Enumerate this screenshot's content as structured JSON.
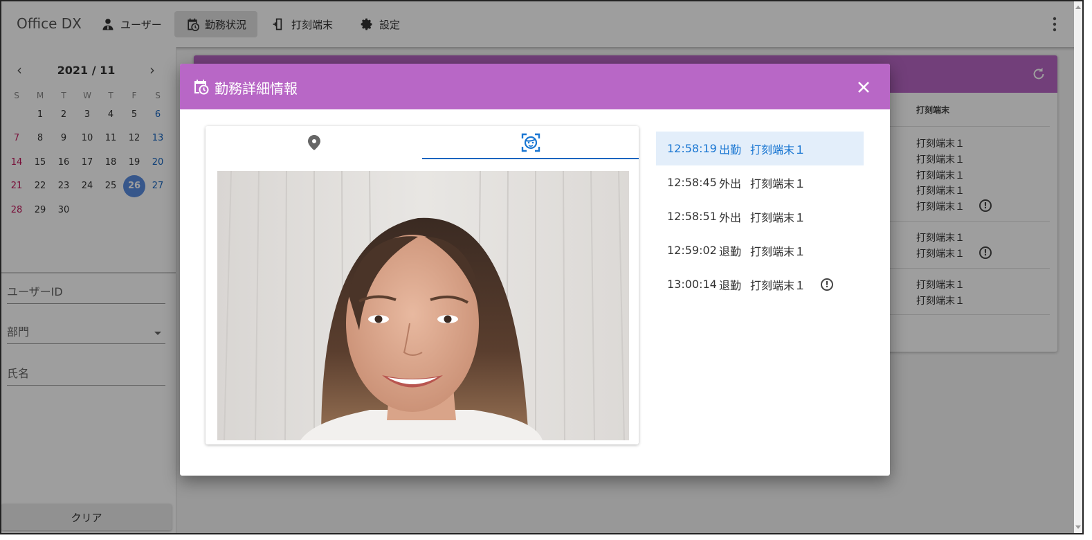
{
  "app": {
    "brand": "Office DX"
  },
  "nav": [
    {
      "label": "ユーザー",
      "icon": "user-icon"
    },
    {
      "label": "勤務状況",
      "icon": "calendar-clock-icon",
      "active": true
    },
    {
      "label": "打刻端末",
      "icon": "device-icon"
    },
    {
      "label": "設定",
      "icon": "gear-icon"
    }
  ],
  "calendar": {
    "title": "2021 / 11",
    "dow": [
      "S",
      "M",
      "T",
      "W",
      "T",
      "F",
      "S"
    ],
    "weeks": [
      [
        "",
        "1",
        "2",
        "3",
        "4",
        "5",
        "6"
      ],
      [
        "7",
        "8",
        "9",
        "10",
        "11",
        "12",
        "13"
      ],
      [
        "14",
        "15",
        "16",
        "17",
        "18",
        "19",
        "20"
      ],
      [
        "21",
        "22",
        "23",
        "24",
        "25",
        "26",
        "27"
      ],
      [
        "28",
        "29",
        "30",
        "",
        "",
        "",
        ""
      ]
    ],
    "selected": "26"
  },
  "filters": {
    "user_id": "ユーザーID",
    "department": "部門",
    "name": "氏名"
  },
  "clear_label": "クリア",
  "table": {
    "header": "打刻端末",
    "groups": [
      {
        "rows": [
          "打刻端末１",
          "打刻端末１",
          "打刻端末１",
          "打刻端末１",
          "打刻端末１"
        ],
        "warn_row": 4
      },
      {
        "rows": [
          "打刻端末１",
          "打刻端末１"
        ],
        "warn_row": 1
      },
      {
        "rows": [
          "打刻端末１",
          "打刻端末１"
        ],
        "warn_row": -1
      }
    ]
  },
  "modal": {
    "title": "勤務詳細情報",
    "tabs": [
      {
        "icon": "location-pin-icon"
      },
      {
        "icon": "face-recognition-icon",
        "active": true
      }
    ],
    "records": [
      {
        "time": "12:58:19",
        "kind": "出勤",
        "device": "打刻端末１",
        "selected": true,
        "warn": false
      },
      {
        "time": "12:58:45",
        "kind": "外出",
        "device": "打刻端末１",
        "selected": false,
        "warn": false
      },
      {
        "time": "12:58:51",
        "kind": "外出",
        "device": "打刻端末１",
        "selected": false,
        "warn": false
      },
      {
        "time": "12:59:02",
        "kind": "退勤",
        "device": "打刻端末１",
        "selected": false,
        "warn": false
      },
      {
        "time": "13:00:14",
        "kind": "退勤",
        "device": "打刻端末１",
        "selected": false,
        "warn": true
      }
    ],
    "warn_glyph": "!"
  },
  "colors": {
    "accent": "#b867c6",
    "primary": "#1976d2",
    "selected_day": "#5a8de0"
  }
}
